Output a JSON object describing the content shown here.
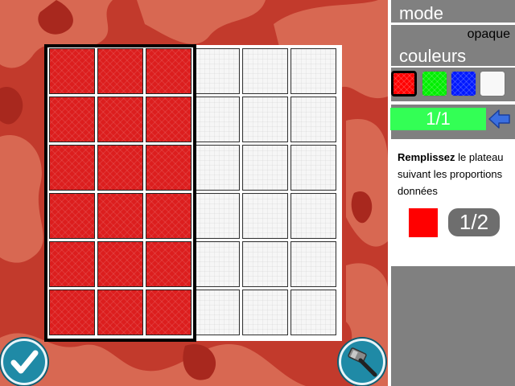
{
  "panel": {
    "mode_label": "mode",
    "mode_value": "opaque",
    "colors_label": "couleurs",
    "swatches": [
      {
        "name": "red",
        "color": "#ff0000",
        "selected": true
      },
      {
        "name": "green",
        "color": "#00ee00",
        "selected": false
      },
      {
        "name": "blue",
        "color": "#0018ff",
        "selected": false
      },
      {
        "name": "white",
        "color": "#f8f8f8",
        "selected": false
      }
    ],
    "progress": "1/1",
    "instructions": {
      "bold": "Remplissez",
      "rest": " le plateau suivant les proportions données"
    },
    "target": {
      "color": "#ff0000",
      "fraction": "1/2"
    }
  },
  "board": {
    "rows": 6,
    "cols": 6,
    "filled_color": "#dc1e1e",
    "empty_color": "#f6f6f6",
    "cells": [
      [
        "red",
        "red",
        "red",
        "white",
        "white",
        "white"
      ],
      [
        "red",
        "red",
        "red",
        "white",
        "white",
        "white"
      ],
      [
        "red",
        "red",
        "red",
        "white",
        "white",
        "white"
      ],
      [
        "red",
        "red",
        "red",
        "white",
        "white",
        "white"
      ],
      [
        "red",
        "red",
        "red",
        "white",
        "white",
        "white"
      ],
      [
        "red",
        "red",
        "red",
        "white",
        "white",
        "white"
      ]
    ]
  },
  "buttons": {
    "validate_icon": "checkmark-icon",
    "tool_icon": "hammer-icon",
    "back_icon": "back-arrow-icon"
  }
}
